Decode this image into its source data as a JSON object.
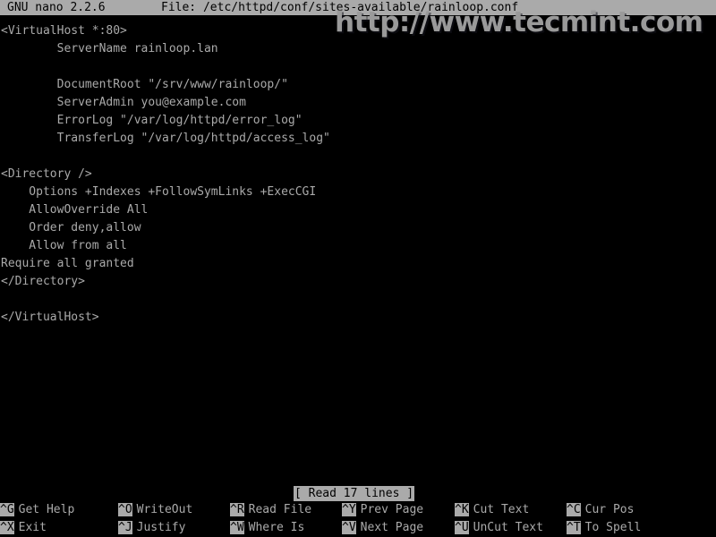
{
  "titlebar": {
    "app": "GNU nano 2.2.6",
    "file_label": "File: /etc/httpd/conf/sites-available/rainloop.conf"
  },
  "editor": {
    "lines": [
      "<VirtualHost *:80>",
      "        ServerName rainloop.lan",
      "",
      "        DocumentRoot \"/srv/www/rainloop/\"",
      "        ServerAdmin you@example.com",
      "        ErrorLog \"/var/log/httpd/error_log\"",
      "        TransferLog \"/var/log/httpd/access_log\"",
      "",
      "<Directory />",
      "    Options +Indexes +FollowSymLinks +ExecCGI",
      "    AllowOverride All",
      "    Order deny,allow",
      "    Allow from all",
      "Require all granted",
      "</Directory>",
      "",
      "</VirtualHost>"
    ]
  },
  "status": {
    "message": "[ Read 17 lines ]"
  },
  "keybar": {
    "columns_x": [
      0,
      132,
      257,
      382,
      508,
      633
    ],
    "rows": [
      [
        {
          "key": "^G",
          "label": "Get Help"
        },
        {
          "key": "^O",
          "label": "WriteOut"
        },
        {
          "key": "^R",
          "label": "Read File"
        },
        {
          "key": "^Y",
          "label": "Prev Page"
        },
        {
          "key": "^K",
          "label": "Cut Text"
        },
        {
          "key": "^C",
          "label": "Cur Pos"
        }
      ],
      [
        {
          "key": "^X",
          "label": "Exit"
        },
        {
          "key": "^J",
          "label": "Justify"
        },
        {
          "key": "^W",
          "label": "Where Is"
        },
        {
          "key": "^V",
          "label": "Next Page"
        },
        {
          "key": "^U",
          "label": "UnCut Text"
        },
        {
          "key": "^T",
          "label": "To Spell"
        }
      ]
    ]
  },
  "watermark": {
    "text": "http://www.tecmint.com"
  },
  "colors": {
    "background": "#000000",
    "foreground": "#aaaaaa",
    "inverse_bg": "#aaaaaa",
    "inverse_fg": "#000000",
    "watermark": "#9a9a9a"
  }
}
